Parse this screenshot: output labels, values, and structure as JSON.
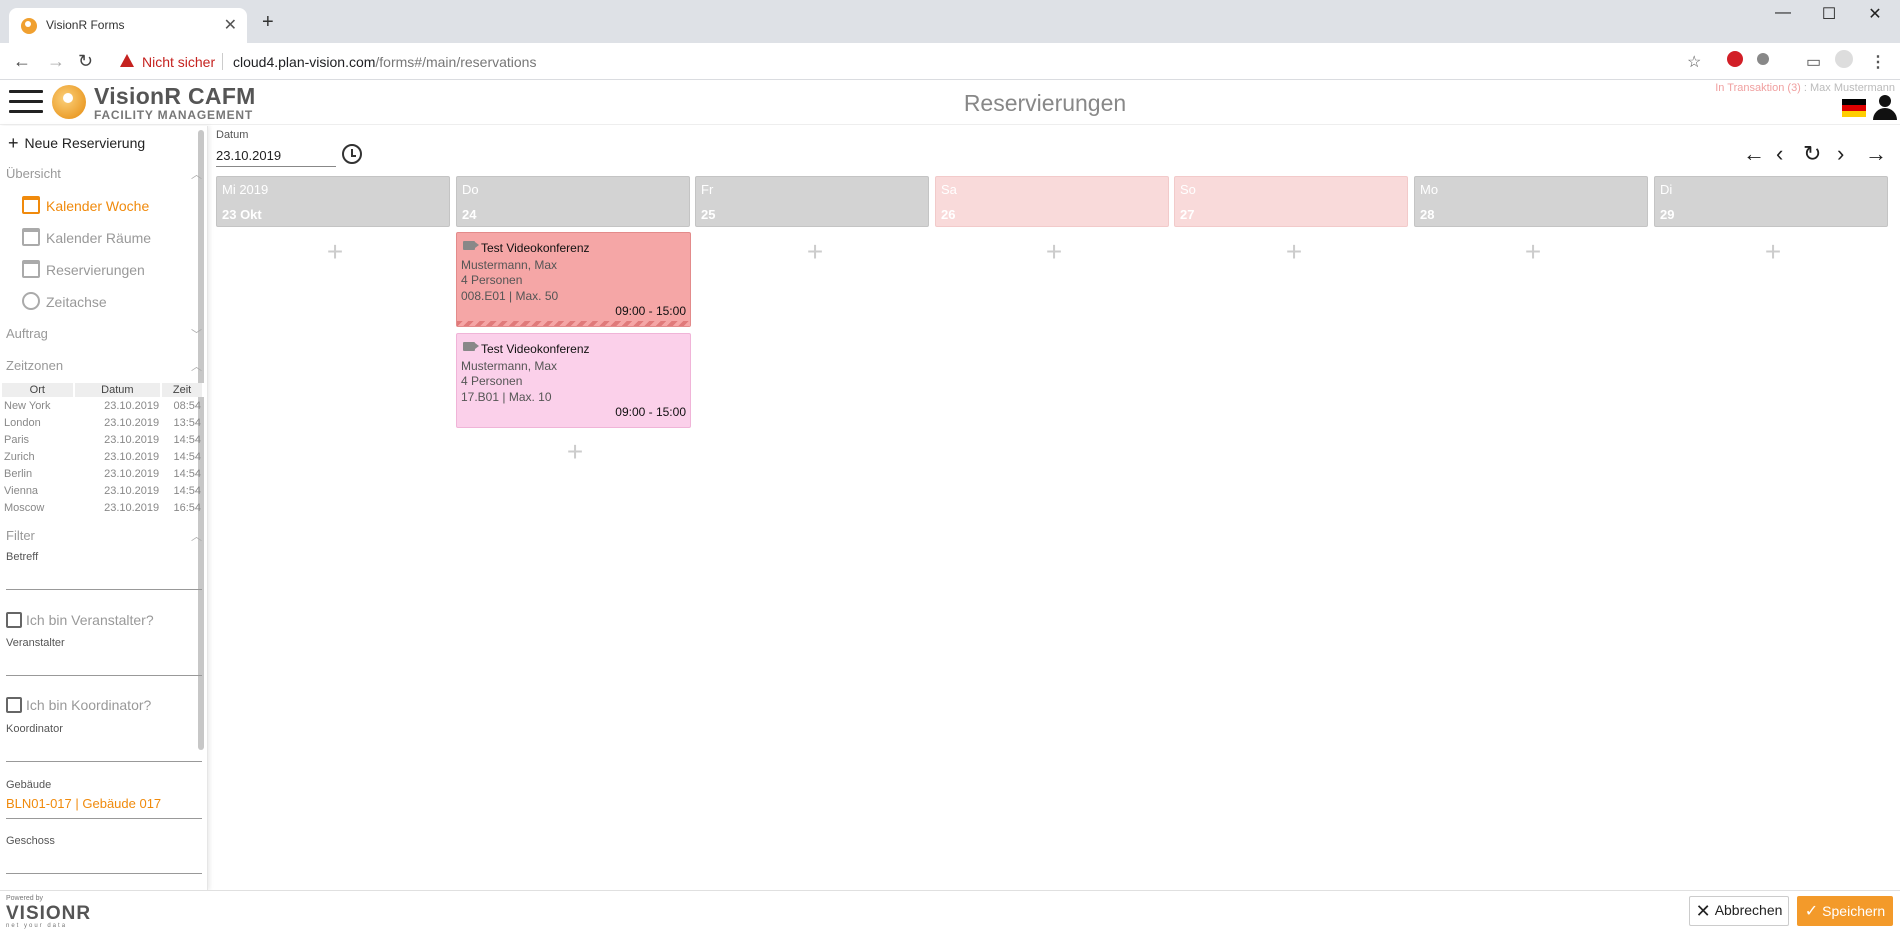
{
  "browser": {
    "tab_title": "VisionR Forms",
    "security_label": "Nicht sicher",
    "url_host": "cloud4.plan-vision.com",
    "url_path": "/forms#/main/reservations"
  },
  "header": {
    "app_name": "VisionR CAFM",
    "app_subtitle": "FACILITY MANAGEMENT",
    "page_title": "Reservierungen",
    "transaction_label": "In Transaktion (3)",
    "user_separator": " : ",
    "user_name": "Max Mustermann"
  },
  "sidebar": {
    "new_reservation": "Neue Reservierung",
    "sections": {
      "overview": "Übersicht",
      "order": "Auftrag",
      "timezones": "Zeitzonen",
      "filter": "Filter"
    },
    "nav": [
      {
        "label": "Kalender Woche",
        "active": true
      },
      {
        "label": "Kalender Räume",
        "active": false
      },
      {
        "label": "Reservierungen",
        "active": false
      },
      {
        "label": "Zeitachse",
        "active": false
      }
    ],
    "timezone_table": {
      "headers": [
        "Ort",
        "Datum",
        "Zeit"
      ],
      "rows": [
        [
          "New York",
          "23.10.2019",
          "08:54"
        ],
        [
          "London",
          "23.10.2019",
          "13:54"
        ],
        [
          "Paris",
          "23.10.2019",
          "14:54"
        ],
        [
          "Zurich",
          "23.10.2019",
          "14:54"
        ],
        [
          "Berlin",
          "23.10.2019",
          "14:54"
        ],
        [
          "Vienna",
          "23.10.2019",
          "14:54"
        ],
        [
          "Moscow",
          "23.10.2019",
          "16:54"
        ]
      ]
    },
    "filter": {
      "subject_label": "Betreff",
      "is_organizer": "Ich bin Veranstalter?",
      "organizer_label": "Veranstalter",
      "is_coordinator": "Ich bin Koordinator?",
      "coordinator_label": "Koordinator",
      "building_label": "Gebäude",
      "building_value": "BLN01-017 | Gebäude 017",
      "floor_label": "Geschoss"
    }
  },
  "calendar": {
    "date_label": "Datum",
    "date_value": "23.10.2019",
    "days": [
      {
        "name": "Mi 2019",
        "date": "23  Okt",
        "weekend": false
      },
      {
        "name": "Do",
        "date": "24",
        "weekend": false
      },
      {
        "name": "Fr",
        "date": "25",
        "weekend": false
      },
      {
        "name": "Sa",
        "date": "26",
        "weekend": true
      },
      {
        "name": "So",
        "date": "27",
        "weekend": true
      },
      {
        "name": "Mo",
        "date": "28",
        "weekend": false
      },
      {
        "name": "Di",
        "date": "29",
        "weekend": false
      }
    ],
    "events": [
      {
        "title": "Test Videokonferenz",
        "organizer": "Mustermann, Max",
        "persons": "4 Personen",
        "room": "008.E01 | Max. 50",
        "time": "09:00 - 15:00",
        "color": "#f5a6a6"
      },
      {
        "title": "Test Videokonferenz",
        "organizer": "Mustermann, Max",
        "persons": "4 Personen",
        "room": "17.B01 | Max. 10",
        "time": "09:00 - 15:00",
        "color": "#fbd0ea"
      }
    ]
  },
  "footer": {
    "powered_by": "Powered by",
    "brand": "VISIONR",
    "tagline": "net your data",
    "cancel_label": "Abbrechen",
    "save_label": "Speichern"
  },
  "colors": {
    "accent": "#f08a0c",
    "save_button": "#f39a2a",
    "weekend_header": "#f9dada",
    "weekday_header": "#d3d3d3"
  }
}
